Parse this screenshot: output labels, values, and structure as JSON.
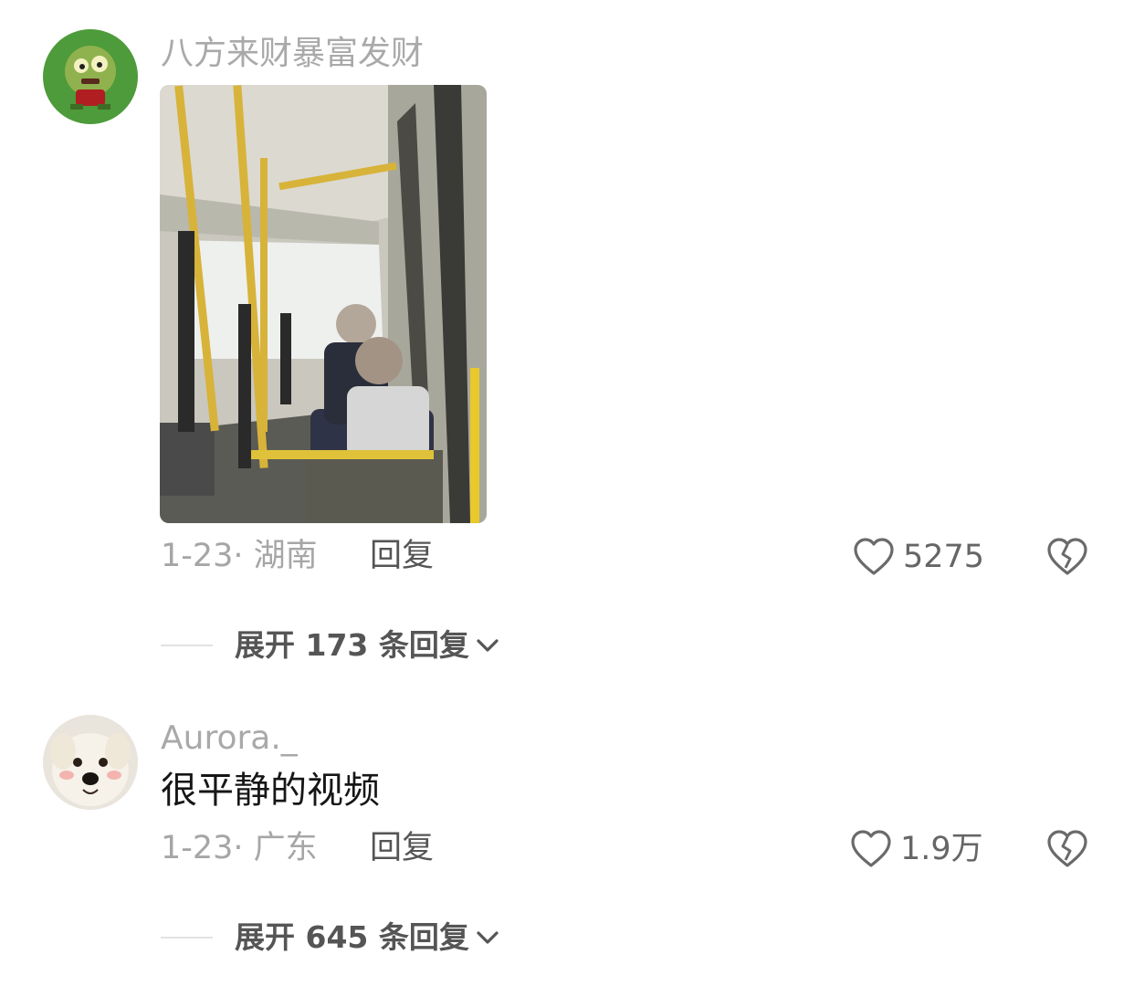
{
  "comments": [
    {
      "username": "八方来财暴富发财",
      "text": "",
      "has_image": true,
      "date_location": "1-23· 湖南",
      "reply_label": "回复",
      "like_count": "5275",
      "expand_label": "展开 173 条回复"
    },
    {
      "username": "Aurora._",
      "text": "很平静的视频",
      "has_image": false,
      "date_location": "1-23· 广东",
      "reply_label": "回复",
      "like_count": "1.9万",
      "expand_label": "展开 645 条回复"
    }
  ],
  "icons": {
    "like": "heart-outline-icon",
    "dislike": "broken-heart-icon",
    "expand": "chevron-down-icon"
  }
}
